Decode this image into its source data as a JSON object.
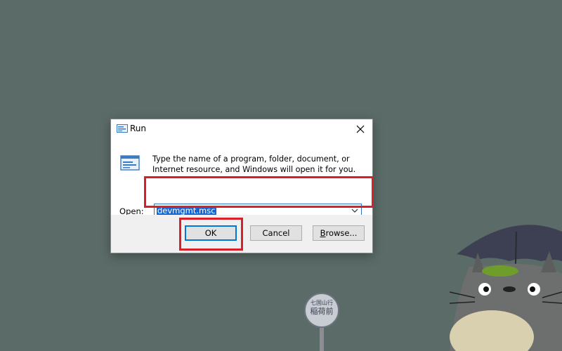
{
  "dialog": {
    "title": "Run",
    "description": "Type the name of a program, folder, document, or Internet resource, and Windows will open it for you.",
    "open_label_accel": "O",
    "open_label_rest": "pen:",
    "open_value": "devmgmt.msc",
    "buttons": {
      "ok": "OK",
      "cancel": "Cancel",
      "browse_accel": "B",
      "browse_rest": "rowse..."
    },
    "icons": {
      "title": "run-icon",
      "body": "run-icon",
      "close": "close-icon",
      "dropdown": "chevron-down-icon"
    }
  },
  "colors": {
    "desktop": "#5b6b67",
    "highlight": "#d8202b",
    "selection": "#1366d6",
    "accent": "#0078d7"
  },
  "wallpaper": {
    "sign_line1": "七国山行",
    "sign_line2": "稲荷前"
  }
}
